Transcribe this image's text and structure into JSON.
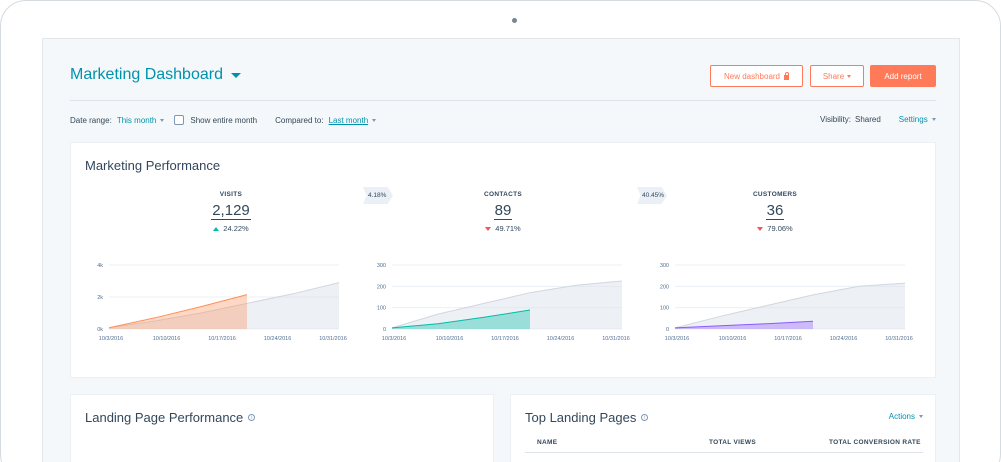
{
  "header": {
    "title": "Marketing Dashboard",
    "new_dashboard_label": "New dashboard",
    "share_label": "Share",
    "add_report_label": "Add report"
  },
  "filters": {
    "date_range_label": "Date range:",
    "date_range_value": "This month",
    "show_entire_month_label": "Show entire month",
    "compared_to_label": "Compared to:",
    "compared_to_value": "Last month",
    "visibility_label": "Visibility:",
    "visibility_value": "Shared",
    "settings_label": "Settings"
  },
  "performance": {
    "title": "Marketing Performance",
    "conversion_rates": [
      "4.18%",
      "40.45%"
    ],
    "kpis": [
      {
        "label": "VISITS",
        "value": "2,129",
        "change": "24.22%",
        "direction": "up"
      },
      {
        "label": "CONTACTS",
        "value": "89",
        "change": "49.71%",
        "direction": "down"
      },
      {
        "label": "CUSTOMERS",
        "value": "36",
        "change": "79.06%",
        "direction": "down"
      }
    ]
  },
  "chart_data": [
    {
      "type": "area",
      "title": "",
      "x": [
        "10/3/2016",
        "10/10/2016",
        "10/17/2016",
        "10/24/2016",
        "10/31/2016"
      ],
      "y_ticks": [
        "0k",
        "2k",
        "4k"
      ],
      "ylim": [
        0,
        4000
      ],
      "series": [
        {
          "role": "previous",
          "color": "#e5e8eb",
          "values": [
            80,
            500,
            1000,
            1600,
            2200,
            2900
          ]
        },
        {
          "role": "current",
          "color": "#ff8f59",
          "values": [
            80,
            700,
            1400,
            2150
          ]
        }
      ],
      "grid": true
    },
    {
      "type": "area",
      "title": "",
      "x": [
        "10/3/2016",
        "10/10/2016",
        "10/17/2016",
        "10/24/2016",
        "10/31/2016"
      ],
      "y_ticks": [
        "0",
        "100",
        "200",
        "300"
      ],
      "ylim": [
        0,
        300
      ],
      "series": [
        {
          "role": "previous",
          "color": "#e5e8eb",
          "values": [
            5,
            70,
            120,
            170,
            205,
            225
          ]
        },
        {
          "role": "current",
          "color": "#00bda5",
          "values": [
            5,
            25,
            55,
            89
          ]
        }
      ],
      "grid": true
    },
    {
      "type": "area",
      "title": "",
      "x": [
        "10/3/2016",
        "10/10/2016",
        "10/17/2016",
        "10/24/2016",
        "10/31/2016"
      ],
      "y_ticks": [
        "0",
        "100",
        "200",
        "300"
      ],
      "ylim": [
        0,
        300
      ],
      "series": [
        {
          "role": "previous",
          "color": "#e5e8eb",
          "values": [
            5,
            60,
            110,
            160,
            200,
            215
          ]
        },
        {
          "role": "current",
          "color": "#8f59ff",
          "values": [
            5,
            15,
            25,
            36
          ]
        }
      ],
      "grid": true
    }
  ],
  "landing_performance": {
    "title": "Landing Page Performance"
  },
  "top_landing_pages": {
    "title": "Top Landing Pages",
    "actions_label": "Actions",
    "columns": [
      "NAME",
      "TOTAL VIEWS",
      "TOTAL CONVERSION RATE"
    ]
  }
}
